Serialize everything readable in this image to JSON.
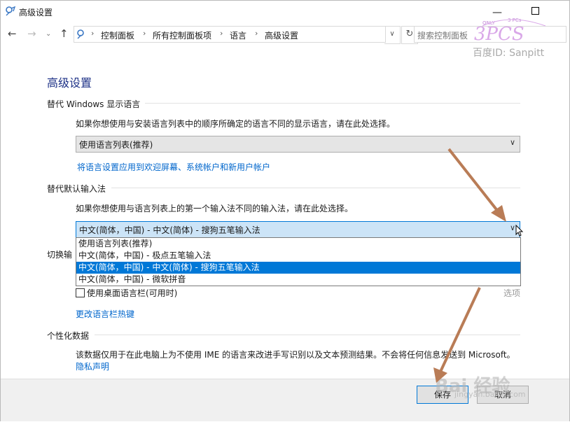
{
  "window": {
    "title": "高级设置"
  },
  "address": {
    "crumbs": [
      "控制面板",
      "所有控制面板项",
      "语言",
      "高级设置"
    ],
    "search_placeholder": "搜索控制面板"
  },
  "watermark": {
    "id_text": "百度ID: Sanpitt",
    "logo_text": "3PCS",
    "only_text": "ONLY",
    "pcs_text": "3 PCs"
  },
  "page": {
    "heading": "高级设置",
    "display_lang": {
      "title": "替代 Windows 显示语言",
      "desc": "如果你想使用与安装语言列表中的顺序所确定的语言不同的显示语言，请在此处选择。",
      "selected": "使用语言列表(推荐)",
      "apply_link": "将语言设置应用到欢迎屏幕、系统帐户和新用户帐户"
    },
    "input_method": {
      "title": "替代默认输入法",
      "desc": "如果你想使用与语言列表上的第一个输入法不同的输入法，请在此处选择。",
      "selected": "中文(简体，中国) - 中文(简体) - 搜狗五笔输入法",
      "options": [
        "使用语言列表(推荐)",
        "中文(简体，中国) - 极点五笔输入法",
        "中文(简体，中国) - 中文(简体) - 搜狗五笔输入法",
        "中文(简体，中国) - 微软拼音"
      ],
      "selected_index": 2
    },
    "switch_method": {
      "title_partial": "切换输",
      "use_desktop_bar": "使用桌面语言栏(可用时)",
      "options_link": "选项",
      "hotkeys_link": "更改语言栏热键"
    },
    "personal": {
      "title": "个性化数据",
      "desc": "该数据仅用于在此电脑上为不使用 IME 的语言来改进手写识别以及文本预测结果。不会将任何信息发送到 Microsoft。",
      "privacy_link": "隐私声明"
    }
  },
  "footer": {
    "save": "保存",
    "cancel": "取消"
  },
  "baidu": {
    "mark": "Bai 经验",
    "url": "jingyan.baidu.com"
  },
  "colors": {
    "accent": "#0078d7",
    "link": "#0066cc",
    "heading": "#1e3287",
    "arrow": "#b97c56"
  }
}
